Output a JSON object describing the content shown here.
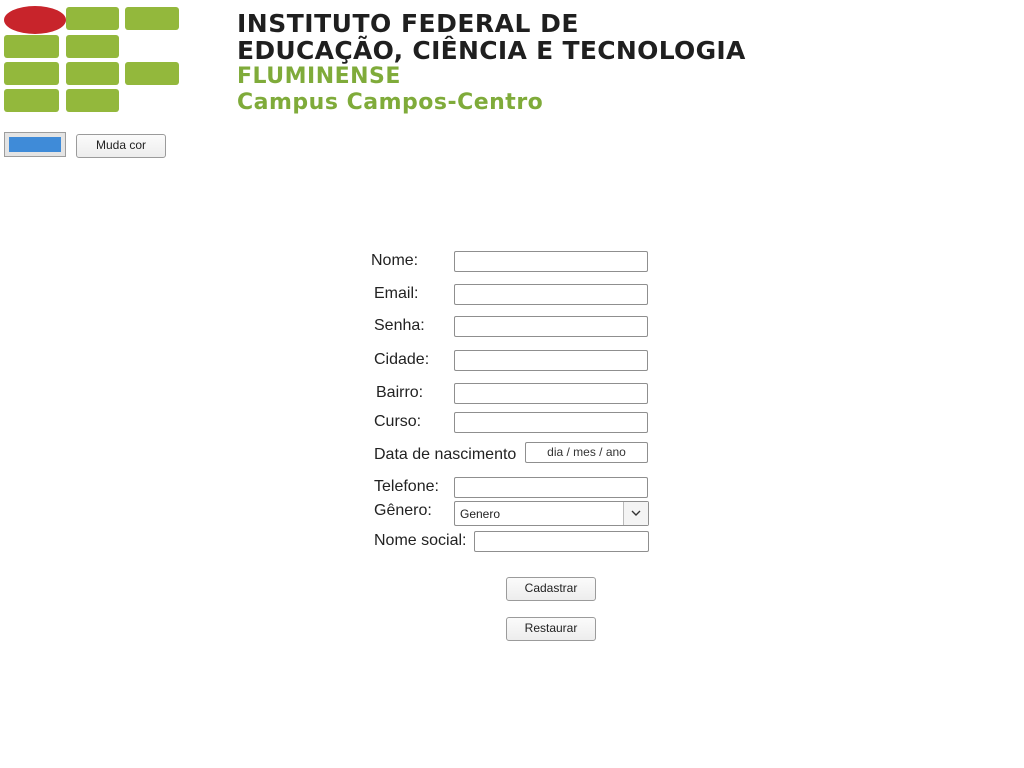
{
  "banner": {
    "line1": "INSTITUTO FEDERAL DE",
    "line2": "EDUCAÇÃO, CIÊNCIA E TECNOLOGIA",
    "line3": "FLUMINENSE",
    "line4": "Campus Campos-Centro",
    "colors": {
      "dark_text": "#1f1f1f",
      "green": "#7fab3a",
      "logo_red": "#c8242b",
      "logo_green": "#93b83c"
    }
  },
  "toolbar": {
    "color_value": "#3f8bd8",
    "change_color_label": "Muda cor"
  },
  "form": {
    "nome_label": "Nome:",
    "email_label": "Email:",
    "senha_label": "Senha:",
    "cidade_label": "Cidade:",
    "bairro_label": "Bairro:",
    "curso_label": "Curso:",
    "data_label": "Data de nascimento",
    "data_placeholder": "dia / mes / ano",
    "telefone_label": "Telefone:",
    "genero_label": "Gênero:",
    "genero_selected": "Genero",
    "nome_social_label": "Nome social:",
    "submit_label": "Cadastrar",
    "reset_label": "Restaurar"
  }
}
